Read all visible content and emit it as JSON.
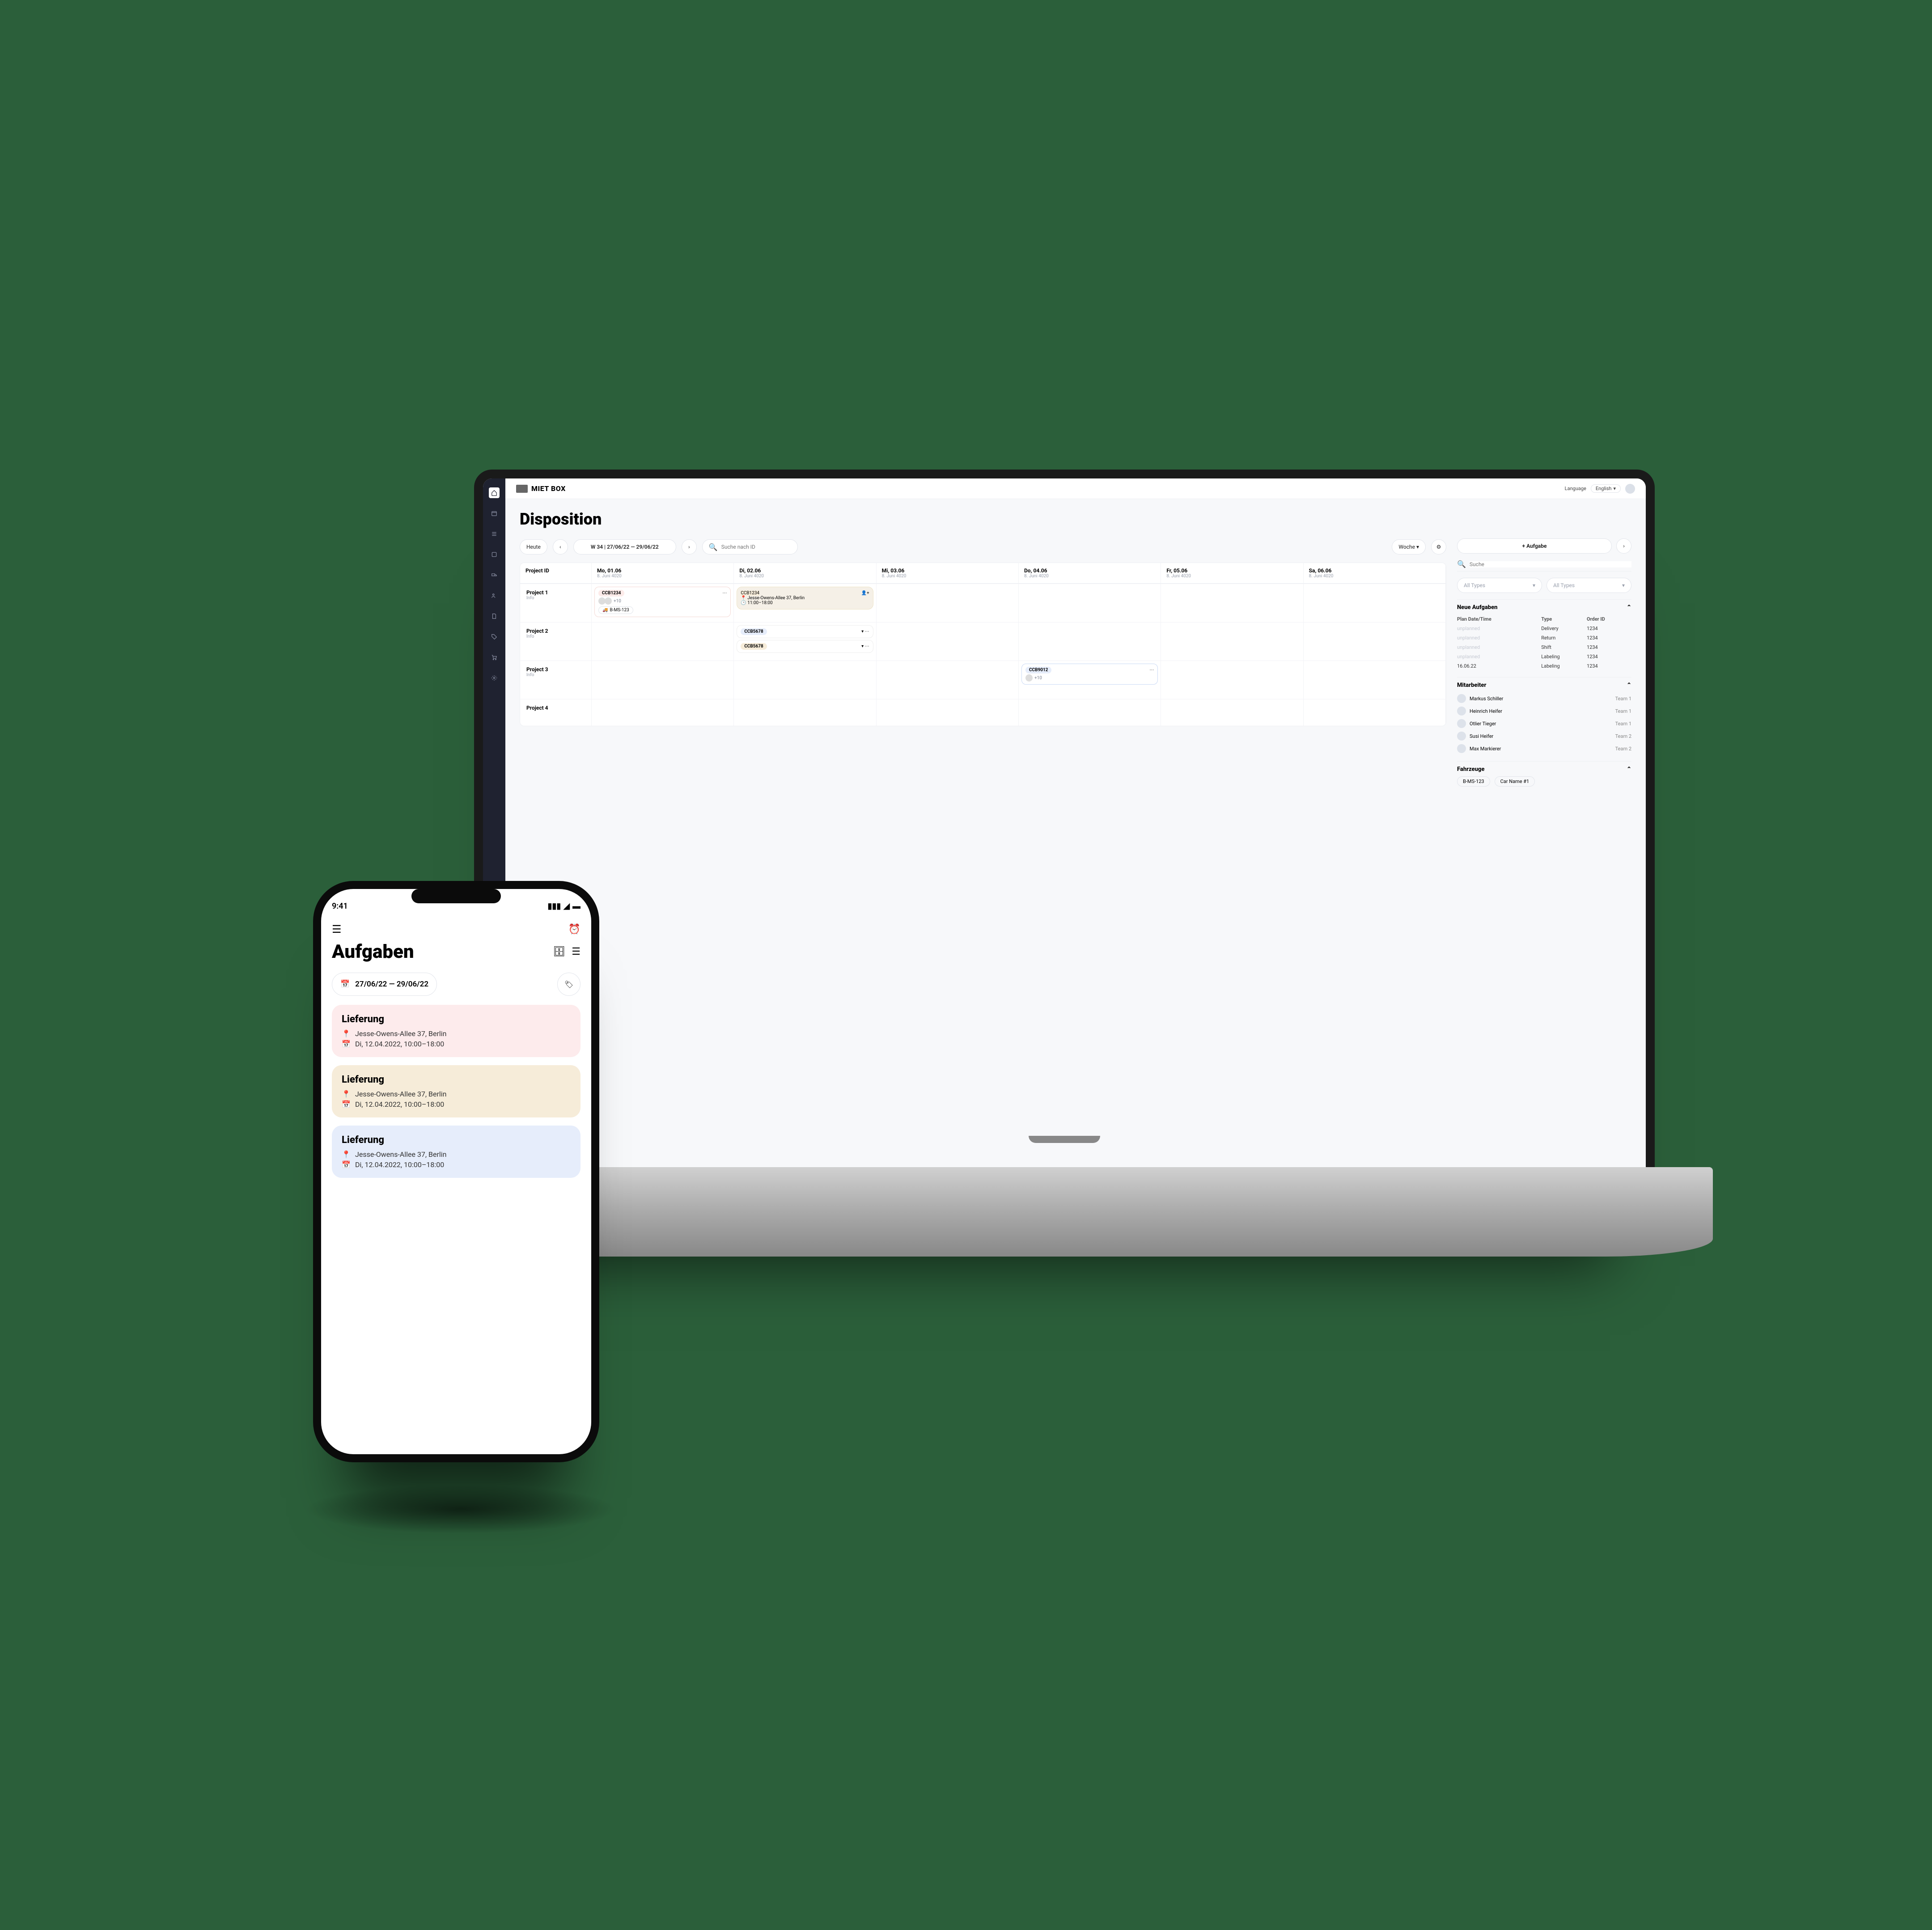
{
  "brand": "MIET BOX",
  "header": {
    "lang_label": "Language",
    "lang_value": "English"
  },
  "page_title": "Disposition",
  "toolbar": {
    "today": "Heute",
    "range": "W 34 | 27/06/22 — 29/06/22",
    "search_ph": "Suche nach ID",
    "view": "Woche"
  },
  "grid": {
    "row_header": "Project ID",
    "days": [
      {
        "d1": "Mo, 01.06",
        "d2": "8. Juni 4020"
      },
      {
        "d1": "Di, 02.06",
        "d2": "8. Juni 4020"
      },
      {
        "d1": "Mi, 03.06",
        "d2": "8. Juni 4020"
      },
      {
        "d1": "Do, 04.06",
        "d2": "8. Juni 4020"
      },
      {
        "d1": "Fr, 05.06",
        "d2": "8. Juni 4020"
      },
      {
        "d1": "Sa, 06.06",
        "d2": "8. Juni 4020"
      }
    ],
    "rows": [
      {
        "name": "Project 1",
        "sub": "Info"
      },
      {
        "name": "Project 2",
        "sub": "Info"
      },
      {
        "name": "Project 3",
        "sub": "Info"
      },
      {
        "name": "Project 4",
        "sub": ""
      }
    ],
    "cards": {
      "p1_mo": {
        "tag": "CCB1234",
        "avatars": 2,
        "extra": "+10",
        "vehicle": "B-MS-123"
      },
      "p1_di_det": {
        "tag": "CCB1234",
        "addr": "Jesse-Owens-Allee 37, Berlin",
        "time": "11:00–18:00"
      },
      "p2_di_a": {
        "tag": "CCB5678"
      },
      "p2_di_b": {
        "tag": "CCB5678"
      },
      "p3_do": {
        "tag": "CCB9012",
        "avatars": 1,
        "extra": "+10"
      }
    }
  },
  "right": {
    "add": "+ Aufgabe",
    "search_ph": "Suche",
    "filter_label": "All Types",
    "sect_new": "Neue Aufgaben",
    "tbl_headers": [
      "Plan Date/Time",
      "Type",
      "Order ID"
    ],
    "rows": [
      {
        "date": "unplanned",
        "type": "Delivery",
        "id": "1234"
      },
      {
        "date": "unplanned",
        "type": "Return",
        "id": "1234"
      },
      {
        "date": "unplanned",
        "type": "Shift",
        "id": "1234"
      },
      {
        "date": "unplanned",
        "type": "Labeling",
        "id": "1234"
      },
      {
        "date": "16.06.22",
        "type": "Labeling",
        "id": "1234"
      }
    ],
    "sect_staff": "Mitarbeiter",
    "staff": [
      {
        "name": "Markus Schiller",
        "team": "Team 1"
      },
      {
        "name": "Heinrich Heifer",
        "team": "Team 1"
      },
      {
        "name": "Otlier Tieger",
        "team": "Team 1"
      },
      {
        "name": "Susi Heifer",
        "team": "Team 2"
      },
      {
        "name": "Max Markierer",
        "team": "Team 2"
      }
    ],
    "sect_veh": "Fahrzeuge",
    "vehicles": [
      "B-MS-123",
      "Car Name #1"
    ]
  },
  "phone": {
    "status_time": "9:41",
    "title": "Aufgaben",
    "date_range": "27/06/22 — 29/06/22",
    "cards": [
      {
        "title": "Lieferung",
        "addr": "Jesse-Owens-Allee 37, Berlin",
        "dt": "Di, 12.04.2022, 10:00–18:00",
        "cls": "c-pink"
      },
      {
        "title": "Lieferung",
        "addr": "Jesse-Owens-Allee 37, Berlin",
        "dt": "Di, 12.04.2022, 10:00–18:00",
        "cls": "c-tan"
      },
      {
        "title": "Lieferung",
        "addr": "Jesse-Owens-Allee 37, Berlin",
        "dt": "Di, 12.04.2022, 10:00–18:00",
        "cls": "c-blue"
      }
    ]
  }
}
